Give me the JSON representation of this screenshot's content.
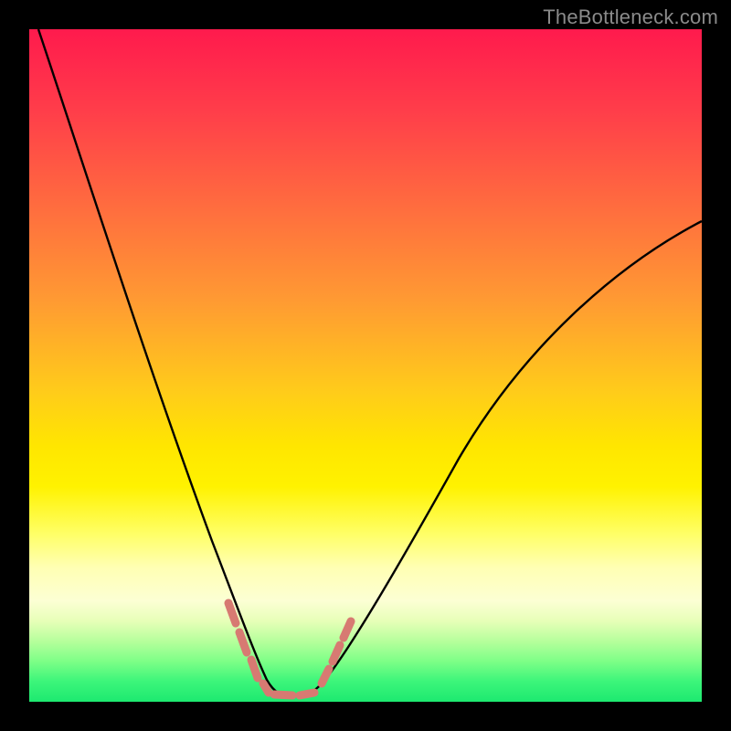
{
  "watermark": "TheBottleneck.com",
  "colors": {
    "frame": "#000000",
    "gradient_top": "#ff1a4d",
    "gradient_bottom": "#1de970",
    "curve": "#000000",
    "marker": "#d77a72"
  },
  "chart_data": {
    "type": "line",
    "title": "",
    "xlabel": "",
    "ylabel": "",
    "xlim": [
      0,
      100
    ],
    "ylim": [
      0,
      100
    ],
    "series": [
      {
        "name": "bottleneck-curve",
        "x": [
          0,
          4,
          8,
          12,
          16,
          20,
          24,
          28,
          30,
          32,
          34,
          36,
          38,
          40,
          42,
          44,
          48,
          54,
          60,
          68,
          76,
          84,
          92,
          100
        ],
        "y": [
          100,
          88,
          76,
          64,
          52,
          41,
          30,
          19,
          14,
          9,
          5,
          2,
          1,
          1,
          2,
          4,
          9,
          18,
          28,
          40,
          50,
          58,
          64,
          69
        ]
      }
    ],
    "markers": {
      "name": "highlight-band",
      "x": [
        29.5,
        31.5,
        33.5,
        35.5,
        37.5,
        40.0,
        42.5,
        44.0,
        45.5,
        47.0
      ],
      "y": [
        12.0,
        8.0,
        4.5,
        2.0,
        1.0,
        1.0,
        2.0,
        4.0,
        6.5,
        9.5
      ]
    }
  }
}
